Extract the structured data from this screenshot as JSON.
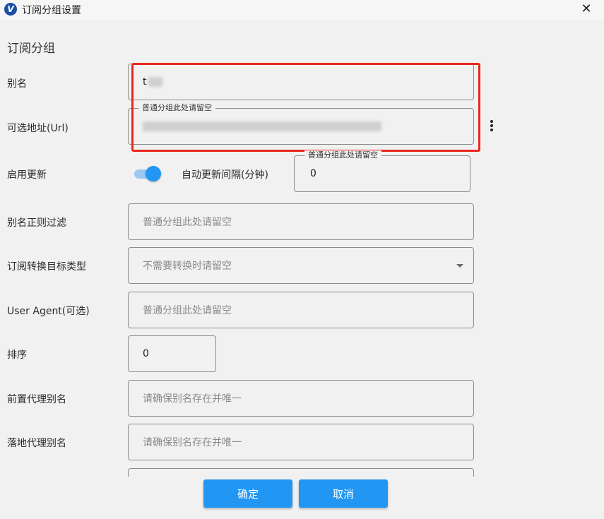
{
  "window": {
    "title": "订阅分组设置",
    "close_glyph": "✕",
    "icon_letter": "V"
  },
  "form": {
    "section_title": "订阅分组",
    "alias": {
      "label": "别名",
      "value": "t"
    },
    "url": {
      "label": "可选地址(Url)",
      "floating_label": "普通分组此处请留空"
    },
    "update": {
      "label": "启用更新",
      "enabled": true,
      "interval_label": "自动更新间隔(分钟)",
      "interval_floating_label": "普通分组此处请留空",
      "interval_value": "0"
    },
    "alias_filter": {
      "label": "别名正则过滤",
      "placeholder": "普通分组此处请留空"
    },
    "convert_target": {
      "label": "订阅转换目标类型",
      "placeholder": "不需要转换时请留空"
    },
    "user_agent": {
      "label": "User Agent(可选)",
      "placeholder": "普通分组此处请留空"
    },
    "sort": {
      "label": "排序",
      "value": "0"
    },
    "front_proxy": {
      "label": "前置代理别名",
      "placeholder": "请确保别名存在并唯一"
    },
    "landing_proxy": {
      "label": "落地代理别名",
      "placeholder": "请确保别名存在并唯一"
    }
  },
  "buttons": {
    "confirm": "确定",
    "cancel": "取消"
  },
  "colors": {
    "accent": "#2196F3",
    "highlight": "#E8271F"
  }
}
